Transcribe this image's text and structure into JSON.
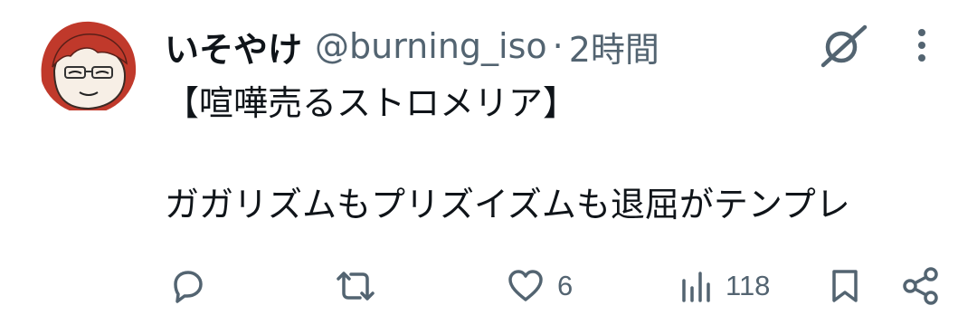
{
  "tweet": {
    "display_name": "いそやけ",
    "handle": "@burning_iso",
    "separator": "·",
    "time": "2時間",
    "text_lines": [
      "【喧嘩売るストロメリア】",
      "",
      "ガガリズムもプリズイズムも退屈がテンプレ"
    ]
  },
  "actions": {
    "reply": {
      "icon": "reply-icon",
      "count": ""
    },
    "retweet": {
      "icon": "retweet-icon",
      "count": ""
    },
    "like": {
      "icon": "heart-icon",
      "count": "6"
    },
    "views": {
      "icon": "views-icon",
      "count": "118"
    },
    "bookmark": {
      "icon": "bookmark-icon"
    },
    "share": {
      "icon": "share-icon"
    }
  },
  "colors": {
    "text": "#0f1419",
    "secondary": "#536471",
    "avatar_hair": "#c0392b",
    "avatar_face": "#f7efe6"
  }
}
